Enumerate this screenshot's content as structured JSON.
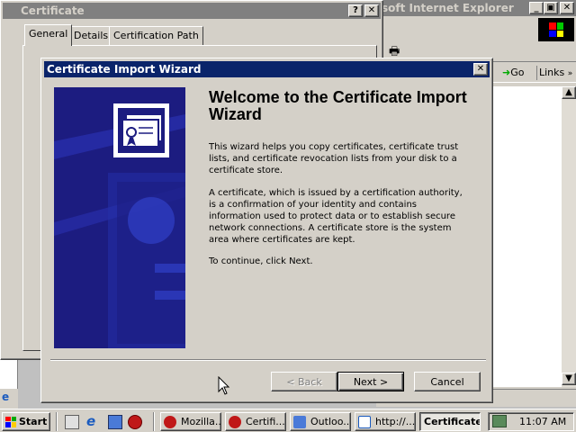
{
  "ie_window": {
    "title": "soft Internet Explorer",
    "go_label": "Go",
    "links_label": "Links"
  },
  "cert_window": {
    "title": "Certificate",
    "help_glyph": "?",
    "close_glyph": "✕",
    "tabs": [
      {
        "label": "General"
      },
      {
        "label": "Details"
      },
      {
        "label": "Certification Path"
      }
    ]
  },
  "wizard": {
    "title": "Certificate Import Wizard",
    "close_glyph": "✕",
    "heading": "Welcome to the Certificate Import Wizard",
    "paragraph1": "This wizard helps you copy certificates, certificate trust lists, and certificate revocation lists from your disk to a certificate store.",
    "paragraph2": "A certificate, which is issued by a certification authority, is a confirmation of your identity and contains information used to protect data or to establish secure network connections. A certificate store is the system area where certificates are kept.",
    "paragraph3": "To continue, click Next.",
    "back_label": "< Back",
    "next_label": "Next >",
    "cancel_label": "Cancel"
  },
  "taskbar": {
    "start_label": "Start",
    "tasks": [
      {
        "label": "Mozilla..."
      },
      {
        "label": "Certifi..."
      },
      {
        "label": "Outloo..."
      },
      {
        "label": "http://..."
      },
      {
        "label": "Certificate"
      }
    ],
    "clock": "11:07 AM"
  },
  "colors": {
    "active_titlebar": "#0a246a",
    "inactive_titlebar": "#808080",
    "face": "#d4d0c8",
    "banner": "#1a1a7a"
  }
}
